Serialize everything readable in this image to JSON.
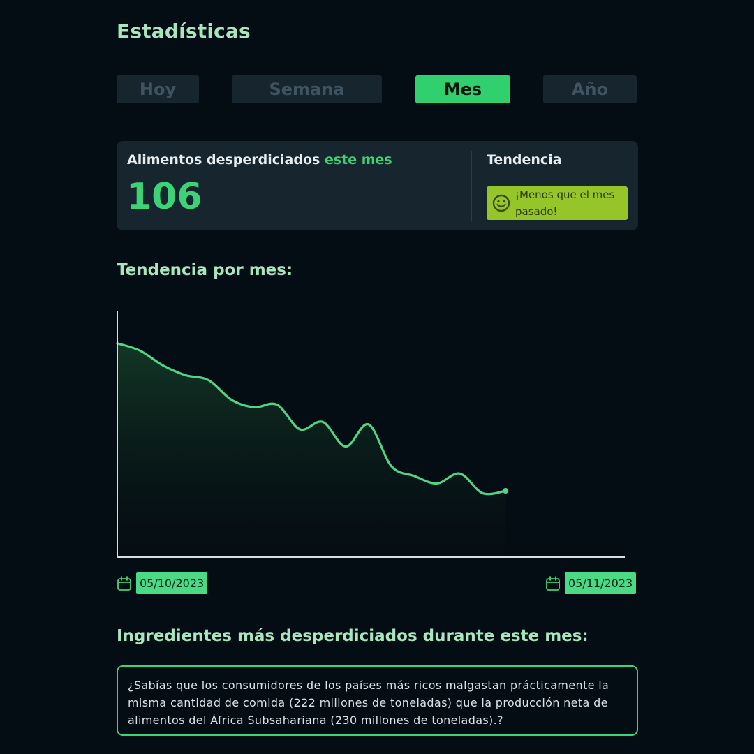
{
  "header": {
    "title": "Estadísticas"
  },
  "tabs": [
    {
      "label": "Hoy",
      "active": false
    },
    {
      "label": "Semana",
      "active": false
    },
    {
      "label": "Mes",
      "active": true
    },
    {
      "label": "Año",
      "active": false
    }
  ],
  "summary": {
    "label_prefix": "Alimentos desperdiciados",
    "label_accent": "este mes",
    "value": "106",
    "trend_label": "Tendencia",
    "trend_message": "¡Menos que el mes pasado!",
    "trend_icon": "smiley-icon"
  },
  "trend_section": {
    "title": "Tendencia por mes:"
  },
  "chart_data": {
    "type": "line",
    "title": "",
    "xlabel": "",
    "ylabel": "",
    "x_start": "05/10/2023",
    "x_end": "05/11/2023",
    "x_fraction_covered": 0.765,
    "values": [
      0.87,
      0.84,
      0.78,
      0.74,
      0.72,
      0.64,
      0.61,
      0.62,
      0.52,
      0.55,
      0.45,
      0.54,
      0.37,
      0.33,
      0.3,
      0.34,
      0.26,
      0.27
    ],
    "ylim": [
      0,
      1
    ],
    "grid": false,
    "legend": "none",
    "line_color": "#52d487",
    "fill": "gradient"
  },
  "date_range": {
    "start": "05/10/2023",
    "end": "05/11/2023",
    "icon": "calendar-icon"
  },
  "ingredients_section": {
    "title": "Ingredientes más desperdiciados durante este mes:",
    "fact": "¿Sabías que los consumidores de los países más ricos malgastan prácticamente la misma cantidad de comida (222 millones de toneladas) que la producción neta de alimentos del África Subsahariana (230 millones de toneladas).?"
  },
  "colors": {
    "background": "#050d14",
    "accent": "#2fd06d",
    "card": "#17252f",
    "trend_badge": "#96c52a"
  }
}
